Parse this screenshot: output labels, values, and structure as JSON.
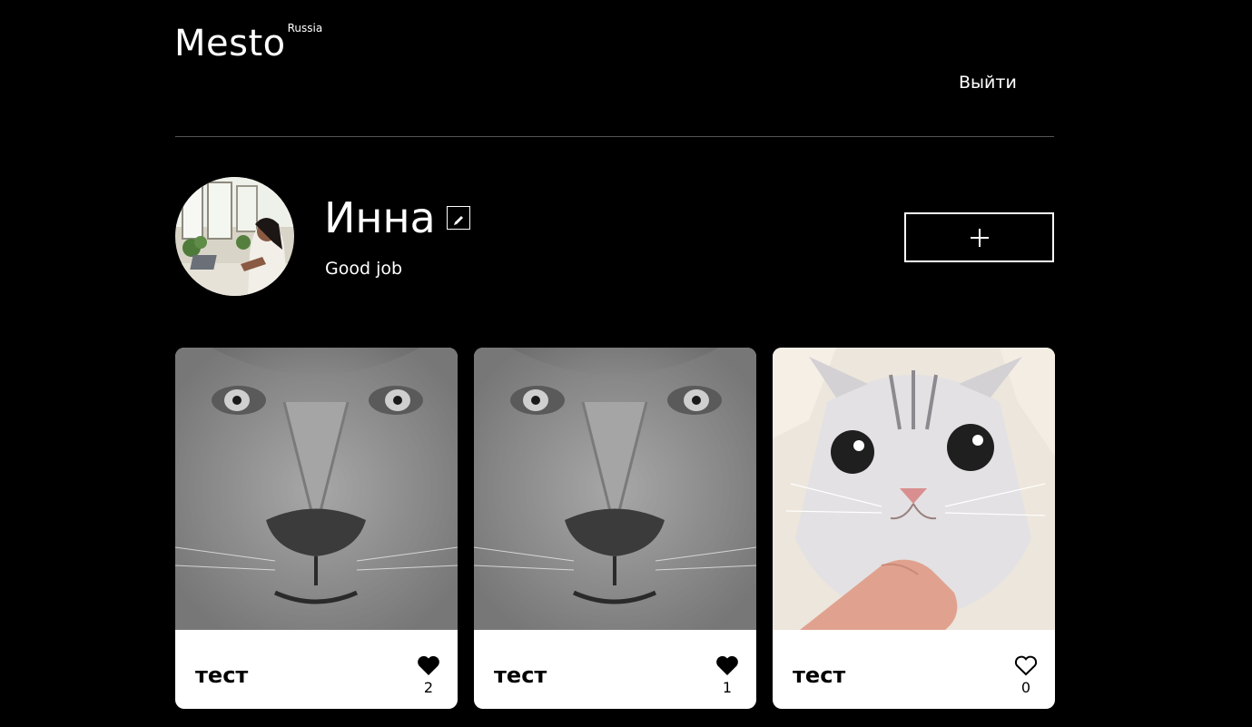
{
  "header": {
    "logo": "Mesto",
    "logo_sub": "Russia",
    "logout_label": "Выйти"
  },
  "profile": {
    "name": "Инна",
    "about": "Good job",
    "edit_icon": "pencil-icon",
    "add_icon": "plus-icon"
  },
  "cards": [
    {
      "title": "тест",
      "likes": "2",
      "liked": true,
      "image": "lion-photo"
    },
    {
      "title": "тест",
      "likes": "1",
      "liked": true,
      "image": "lion-photo"
    },
    {
      "title": "тест",
      "likes": "0",
      "liked": false,
      "image": "cat-photo"
    }
  ]
}
